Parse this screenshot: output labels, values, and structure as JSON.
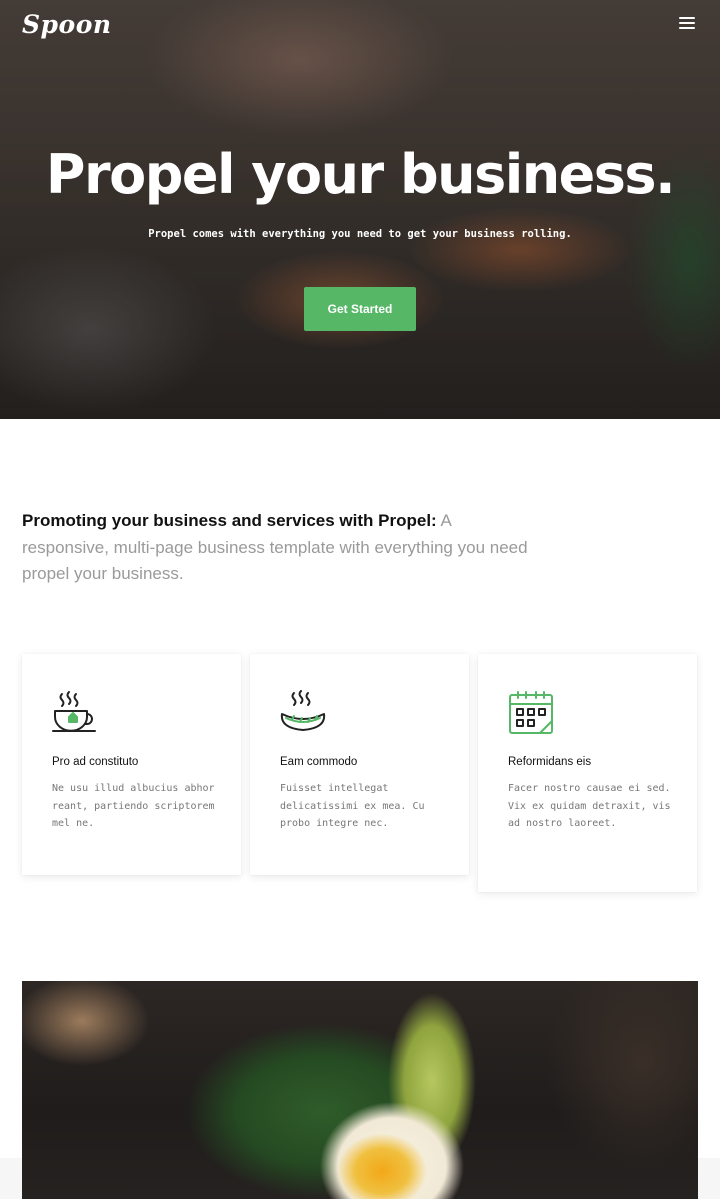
{
  "header": {
    "logo_text": "Spoon",
    "menu_icon": "hamburger-menu-icon"
  },
  "hero": {
    "title": "Propel your business.",
    "subtitle": "Propel comes with everything you need to get your business rolling.",
    "cta_label": "Get Started"
  },
  "intro": {
    "lead": "Promoting your business and services with Propel:",
    "body": " A responsive, multi-page business template with everything you need propel your business."
  },
  "features": [
    {
      "icon": "tea-cup-icon",
      "title": "Pro ad constituto",
      "text": "Ne usu illud albucius abhor reant, partiendo scriptorem mel ne."
    },
    {
      "icon": "sausage-grill-icon",
      "title": "Eam commodo",
      "text": "Fuisset intellegat delicatissimi ex mea. Cu probo integre nec."
    },
    {
      "icon": "calendar-icon",
      "title": "Reformidans eis",
      "text": "Facer nostro causae ei sed. Vix ex quidam detraxit, vis ad nostro laoreet."
    }
  ],
  "colors": {
    "accent": "#56b867",
    "icon_stroke": "#222222"
  }
}
